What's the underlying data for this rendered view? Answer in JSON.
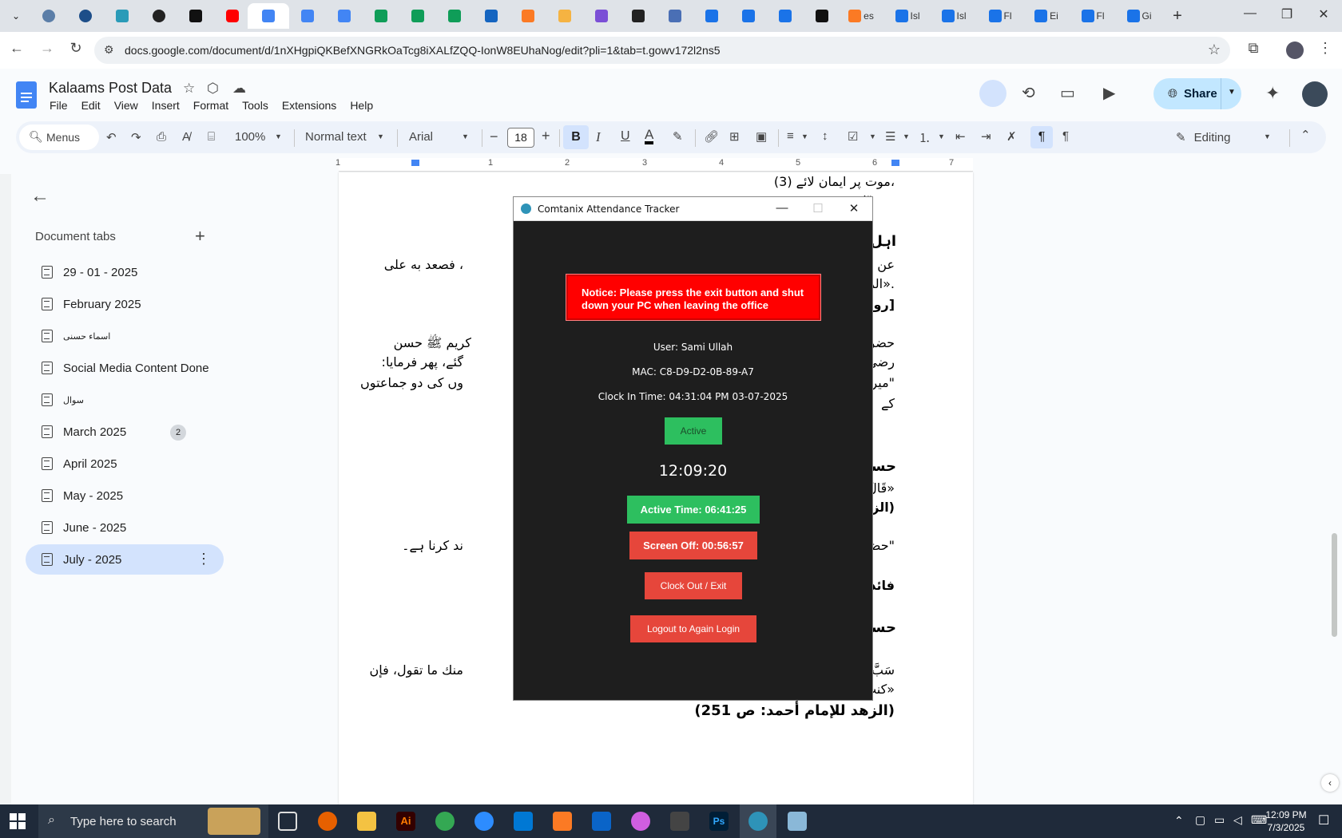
{
  "browser": {
    "tabs": [
      {
        "icon": "chevron-down-icon",
        "label": ""
      },
      {
        "icon": "tab-icon",
        "label": ""
      },
      {
        "icon": "tab-icon",
        "label": ""
      },
      {
        "icon": "tab-icon",
        "label": ""
      },
      {
        "icon": "openai-icon",
        "label": ""
      },
      {
        "icon": "tab-icon",
        "label": ""
      },
      {
        "icon": "youtube-icon",
        "label": ""
      },
      {
        "icon": "docs-icon",
        "label": ""
      },
      {
        "icon": "docs-icon",
        "label": ""
      },
      {
        "icon": "docs-icon",
        "label": ""
      },
      {
        "icon": "sheets-icon",
        "label": ""
      },
      {
        "icon": "sheets-icon",
        "label": ""
      },
      {
        "icon": "sheets-icon",
        "label": ""
      },
      {
        "icon": "tab-icon",
        "label": ""
      },
      {
        "icon": "tab-icon",
        "label": ""
      },
      {
        "icon": "tab-icon",
        "label": ""
      },
      {
        "icon": "tab-icon",
        "label": ""
      },
      {
        "icon": "tab-icon",
        "label": ""
      },
      {
        "icon": "forms-icon",
        "label": ""
      },
      {
        "icon": "forms-icon",
        "label": ""
      },
      {
        "icon": "forms-icon",
        "label": ""
      },
      {
        "icon": "tab-icon",
        "label": ""
      },
      {
        "icon": "tab-icon",
        "label": "es"
      },
      {
        "icon": "forms-icon",
        "label": "Isl"
      },
      {
        "icon": "forms-icon",
        "label": "Isl"
      },
      {
        "icon": "forms-icon",
        "label": "Fl"
      },
      {
        "icon": "forms-icon",
        "label": "Ei"
      },
      {
        "icon": "forms-icon",
        "label": "Fl"
      },
      {
        "icon": "forms-icon",
        "label": "Gi"
      }
    ],
    "new_tab": "+",
    "url": "docs.google.com/document/d/1nXHgpiQKBefXNGRkOaTcg8iXALfZQQ-IonW8EUhaNog/edit?pli=1&tab=t.gowv172l2ns5"
  },
  "docs": {
    "title": "Kalaams Post Data",
    "menu": [
      "File",
      "Edit",
      "View",
      "Insert",
      "Format",
      "Tools",
      "Extensions",
      "Help"
    ],
    "share_label": "Share",
    "toolbar": {
      "menus_search": "Menus",
      "zoom": "100%",
      "style": "Normal text",
      "font": "Arial",
      "font_size": "18",
      "bold": "B",
      "italic": "I",
      "underline": "U",
      "text_color": "A",
      "mode": "Editing"
    },
    "ruler_labels": [
      "1",
      "1",
      "2",
      "3",
      "4",
      "5",
      "6",
      "7"
    ],
    "side_panel": {
      "title": "Document tabs",
      "add": "+",
      "items": [
        {
          "label": "29 - 01 - 2025",
          "badge": ""
        },
        {
          "label": "February 2025",
          "badge": ""
        },
        {
          "label": "اسماء حسنی",
          "badge": ""
        },
        {
          "label": "Social Media Content Done",
          "badge": ""
        },
        {
          "label": "سوال",
          "badge": ""
        },
        {
          "label": "March 2025",
          "badge": "2"
        },
        {
          "label": "April 2025",
          "badge": ""
        },
        {
          "label": "May - 2025",
          "badge": ""
        },
        {
          "label": "June - 2025",
          "badge": ""
        },
        {
          "label": "July - 2025",
          "badge": ""
        }
      ]
    },
    "page_lines": [
      "،موت پر ایمان لائے (3)",
      "\"اور",
      "اہل",
      "عن أ",
      "، فصعد به على",
      ".«الم",
      "[روا",
      "حضر",
      "کریم ﷺ حسن",
      "رضی",
      "گئے، پھر فرمایا:",
      "\"میر",
      "وں کی دو جماعتوں",
      "کے",
      "حسن",
      "«قَالَ",
      "(الزہ",
      "\"حض",
      "ند کرنا ہے۔",
      "فائدہ",
      "حسن",
      "سَبَّ",
      "منك ما تقول، فإن",
      "«كنت",
      "(الزهد للإمام أحمد: ص 251)"
    ]
  },
  "tracker": {
    "title": "Comtanix Attendance Tracker",
    "notice": "Notice: Please press the exit button and shut down your PC when leaving the office",
    "user": "User: Sami Ullah",
    "mac": "MAC: C8-D9-D2-0B-89-A7",
    "clock_in": "Clock In Time: 04:31:04 PM 03-07-2025",
    "status": "Active",
    "clock": "12:09:20",
    "active_time": "Active Time: 06:41:25",
    "screen_off": "Screen Off: 00:56:57",
    "clock_out": "Clock Out / Exit",
    "logout": "Logout to Again Login"
  },
  "taskbar": {
    "search_placeholder": "Type here to search",
    "time": "12:09 PM",
    "date": "7/3/2025"
  },
  "colors": {
    "notice_bg": "#ff0000",
    "active_green": "#2dbf5f",
    "danger_red": "#e6463b",
    "docs_blue": "#4285f4",
    "share_bg": "#c2e7ff"
  }
}
